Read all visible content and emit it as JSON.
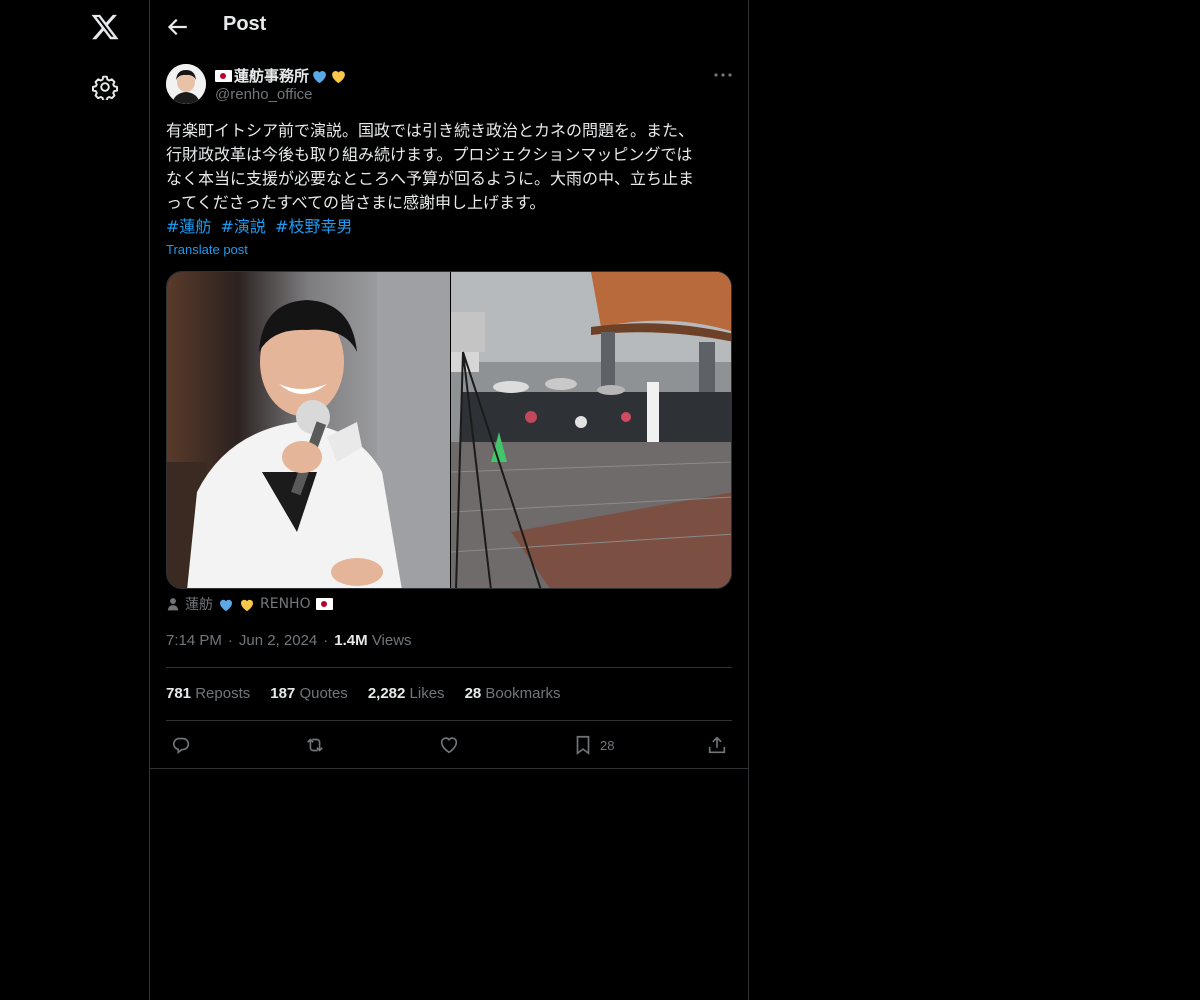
{
  "header": {
    "title": "Post"
  },
  "author": {
    "name": "蓮舫事務所",
    "handle": "@renho_office"
  },
  "post": {
    "text": "有楽町イトシア前で演説。国政では引き続き政治とカネの問題を。また、\n行財政改革は今後も取り組み続けます。プロジェクションマッピングでは\nなく本当に支援が必要なところへ予算が回るように。大雨の中、立ち止ま\nってくださったすべての皆さまに感謝申し上げます。",
    "hashtags": [
      "#蓮舫",
      "#演説",
      "#枝野幸男"
    ],
    "translate_label": "Translate post",
    "tagged_user": "蓮舫",
    "tagged_suffix": "RENHO"
  },
  "meta": {
    "time": "7:14 PM",
    "date": "Jun 2, 2024",
    "views_count": "1.4M",
    "views_label": "Views"
  },
  "stats": {
    "reposts_count": "781",
    "reposts_label": "Reposts",
    "quotes_count": "187",
    "quotes_label": "Quotes",
    "likes_count": "2,282",
    "likes_label": "Likes",
    "bookmarks_count": "28",
    "bookmarks_label": "Bookmarks"
  },
  "actions": {
    "bookmark_count": "28"
  },
  "icons": {
    "nav": [
      "x-logo-icon",
      "gear-icon"
    ],
    "header": [
      "back-arrow-icon"
    ],
    "post": [
      "more-icon",
      "person-icon"
    ],
    "actions": [
      "reply-icon",
      "repost-icon",
      "like-icon",
      "bookmark-icon",
      "share-icon"
    ]
  },
  "colors": {
    "background": "#000000",
    "text": "#e7e9ea",
    "muted": "#71767b",
    "link": "#1d9bf0",
    "border": "#2f3336",
    "blue_heart": "#5aa8e6",
    "yellow_heart": "#f8c84a",
    "flag_red": "#bc002d"
  }
}
